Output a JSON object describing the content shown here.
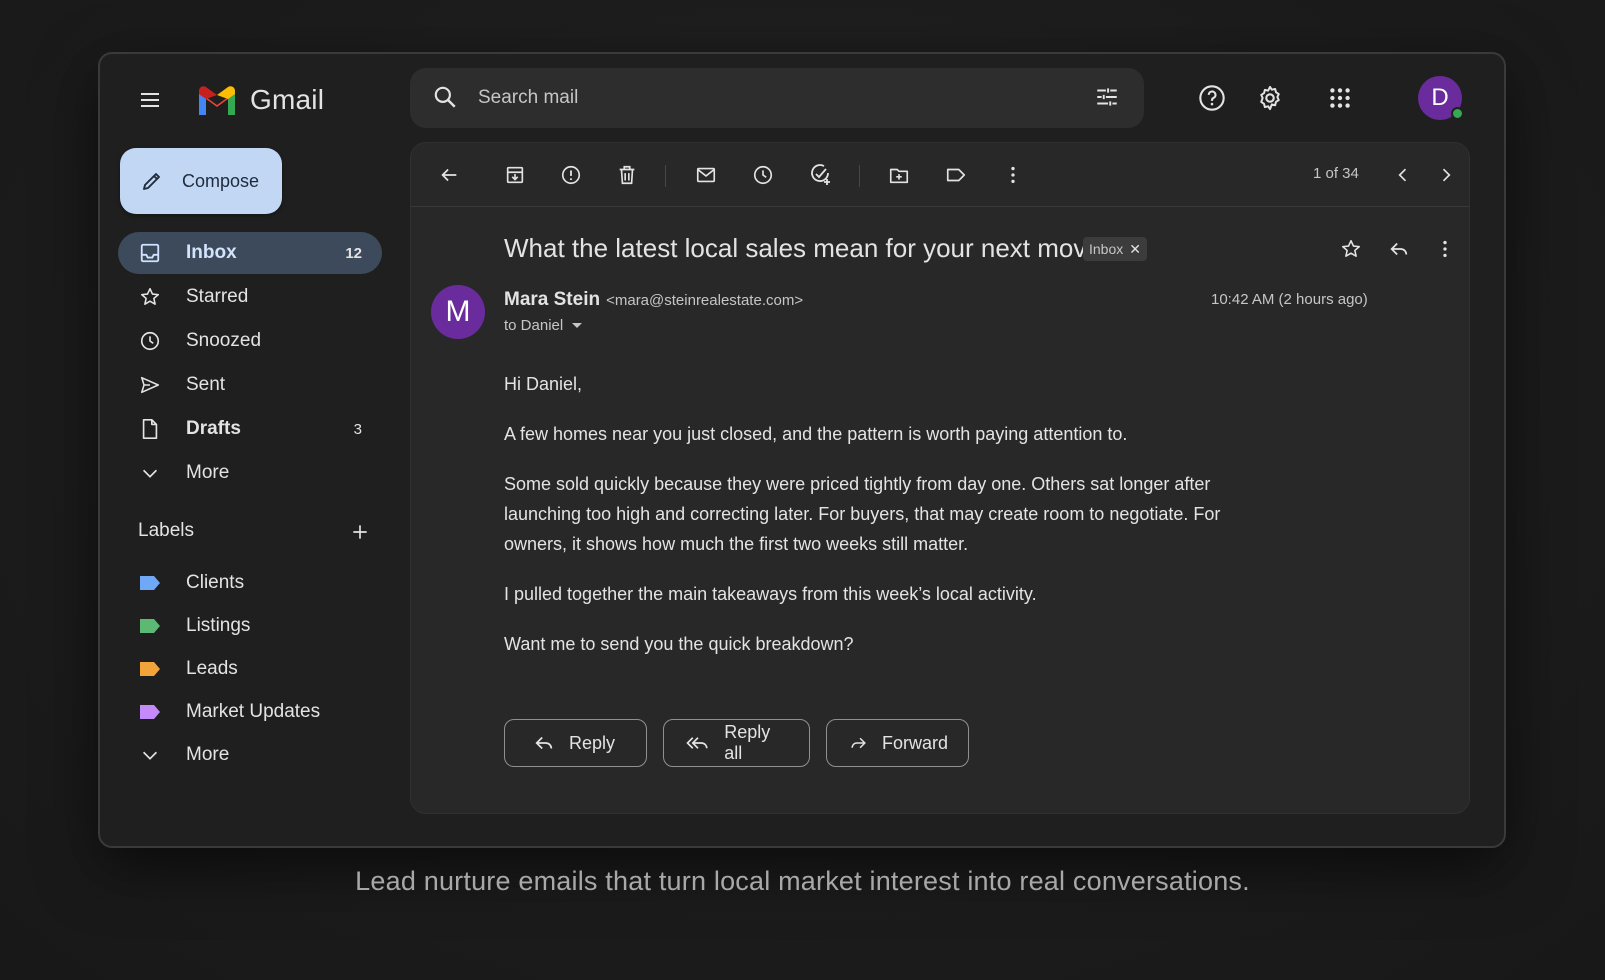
{
  "app": {
    "title": "Gmail"
  },
  "search": {
    "placeholder": "Search mail"
  },
  "sidebar": {
    "compose_label": "Compose",
    "items": [
      {
        "label": "Inbox",
        "count": "12",
        "icon": "inbox-icon"
      },
      {
        "label": "Starred",
        "count": "",
        "icon": "star-icon"
      },
      {
        "label": "Snoozed",
        "count": "",
        "icon": "clock-icon"
      },
      {
        "label": "Sent",
        "count": "",
        "icon": "send-icon"
      },
      {
        "label": "Drafts",
        "count": "3",
        "icon": "draft-icon"
      },
      {
        "label": "More",
        "count": "",
        "icon": "chevron-down-icon"
      }
    ],
    "labels_title": "Labels",
    "labels": [
      {
        "label": "Clients",
        "color": "#6fa8f5"
      },
      {
        "label": "Listings",
        "color": "#5bb974"
      },
      {
        "label": "Leads",
        "color": "#f2a33a"
      },
      {
        "label": "Market Updates",
        "color": "#c58af9"
      },
      {
        "label": "More",
        "color": ""
      }
    ]
  },
  "user": {
    "initial": "D",
    "avatar_color": "#6a2c9c"
  },
  "toolbar": {
    "pager": "1 of 34"
  },
  "email": {
    "subject": "What the latest local sales mean for your next move",
    "chip": "Inbox",
    "sender_initial": "M",
    "sender_name": "Mara Stein",
    "sender_email": "<mara@steinrealestate.com>",
    "to": "to Daniel",
    "time": "10:42 AM (2 hours ago)",
    "body": [
      "Hi Daniel,",
      "A few homes near you just closed, and the pattern is worth paying attention to.",
      "Some sold quickly because they were priced tightly from day one. Others sat longer after launching too high and correcting later. For buyers, that may create room to negotiate. For owners, it shows how much the first two weeks still matter.",
      "I pulled together the main takeaways from this week’s local activity.",
      "Want me to send you the quick breakdown?"
    ]
  },
  "actions": {
    "reply": "Reply",
    "reply_all": "Reply all",
    "forward": "Forward"
  },
  "tagline": "Lead nurture emails that turn local market interest into real conversations."
}
